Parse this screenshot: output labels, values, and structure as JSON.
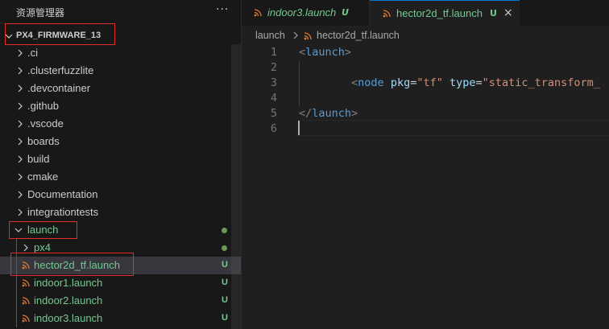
{
  "explorer": {
    "title": "资源管理器",
    "more_icon": "ellipsis-icon",
    "project_name": "PX4_FIRMWARE_13",
    "items": [
      {
        "label": "​.ci"
      },
      {
        "label": ".clusterfuzzlite"
      },
      {
        "label": ".devcontainer"
      },
      {
        "label": ".github"
      },
      {
        "label": ".vscode"
      },
      {
        "label": "boards"
      },
      {
        "label": "build"
      },
      {
        "label": "cmake"
      },
      {
        "label": "Documentation"
      },
      {
        "label": "integrationtests"
      },
      {
        "label": "launch"
      },
      {
        "label": "px4"
      },
      {
        "label": "hector2d_tf.launch",
        "badge": "U"
      },
      {
        "label": "indoor1.launch",
        "badge": "U"
      },
      {
        "label": "indoor2.launch",
        "badge": "U"
      },
      {
        "label": "indoor3.launch",
        "badge": "U"
      }
    ]
  },
  "tabs": [
    {
      "label": "indoor3.launch",
      "badge": "U"
    },
    {
      "label": "hector2d_tf.launch",
      "badge": "U",
      "close": "×"
    }
  ],
  "breadcrumb": {
    "folder": "launch",
    "file": "hector2d_tf.launch"
  },
  "code": {
    "line_numbers": [
      "1",
      "2",
      "3",
      "4",
      "5",
      "6"
    ],
    "line1_open": "<",
    "line1_tag": "launch",
    "line1_close": ">",
    "line3_indent": "        ",
    "line3_open": "<",
    "line3_tag": "node",
    "line3_attr1": " pkg",
    "line3_eq1": "=",
    "line3_val1": "\"tf\"",
    "line3_attr2": " type",
    "line3_eq2": "=",
    "line3_val2": "\"static_transform_",
    "line5_open": "</",
    "line5_tag": "launch",
    "line5_close": ">"
  },
  "colors": {
    "accent": "#0078d4",
    "untracked": "#73c991",
    "highlight_box": "#e32d2d",
    "rss_icon": "#e37933"
  }
}
